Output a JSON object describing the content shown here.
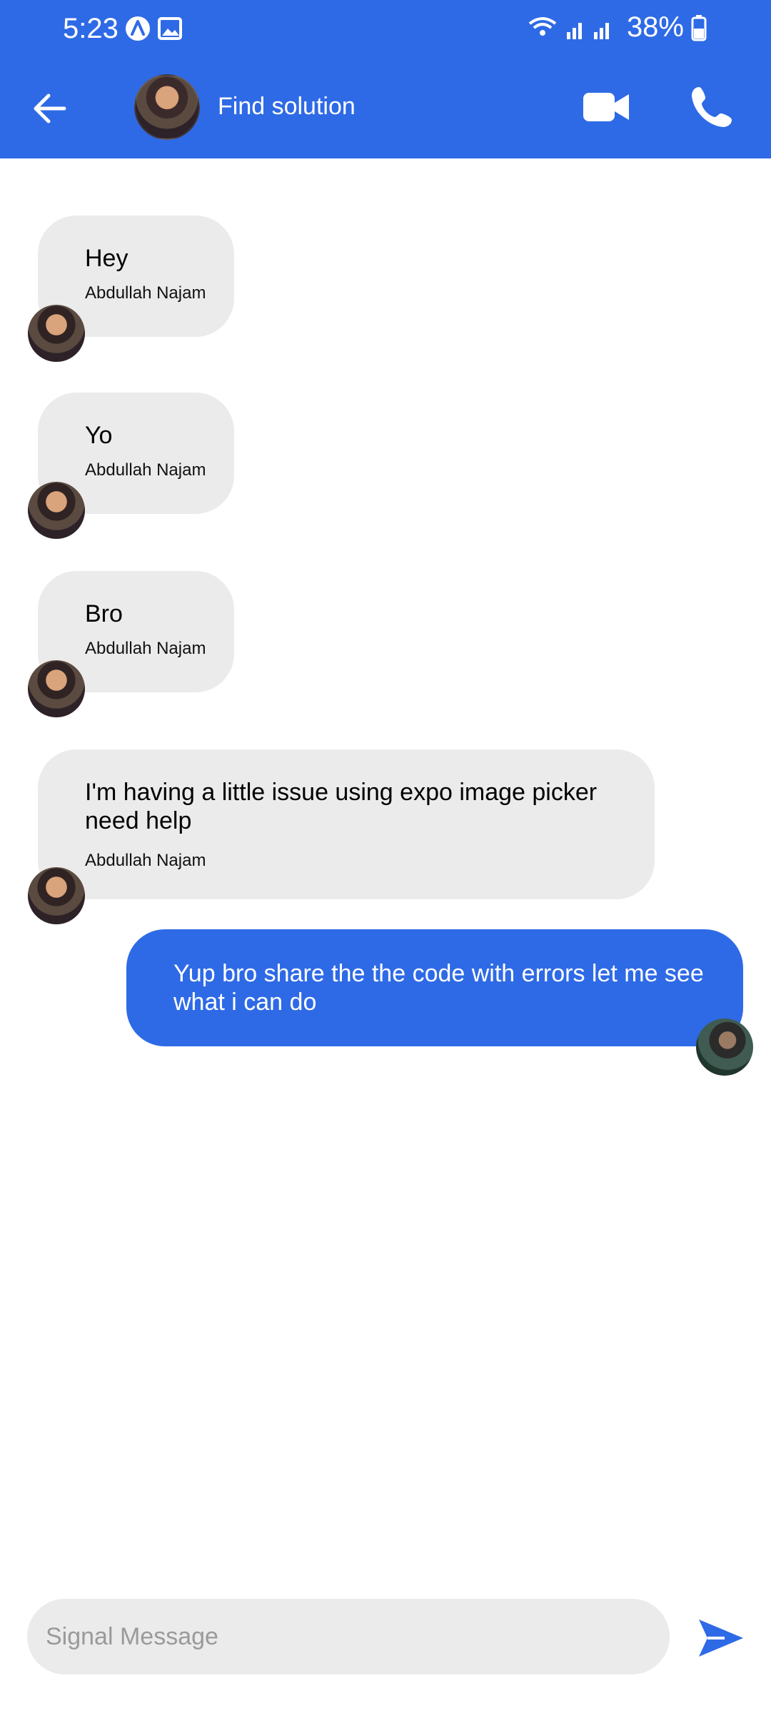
{
  "status_bar": {
    "time": "5:23",
    "battery": "38%"
  },
  "header": {
    "title": "Find solution"
  },
  "messages": [
    {
      "text": "Hey",
      "sender": "Abdullah Najam"
    },
    {
      "text": "Yo",
      "sender": "Abdullah Najam"
    },
    {
      "text": "Bro",
      "sender": "Abdullah Najam"
    },
    {
      "text": "I'm having a little issue using expo image picker need help",
      "sender": "Abdullah Najam"
    },
    {
      "text": "Yup bro share the the code with errors let me see what i can do"
    }
  ],
  "composer": {
    "placeholder": "Signal Message"
  },
  "colors": {
    "accent": "#2e6ae6",
    "incoming_bubble": "#ebebeb"
  },
  "icons": [
    "arrow-left-icon",
    "video-icon",
    "phone-icon",
    "send-icon",
    "wifi-icon",
    "signal-icon",
    "battery-icon",
    "gallery-icon",
    "app-a-icon"
  ]
}
